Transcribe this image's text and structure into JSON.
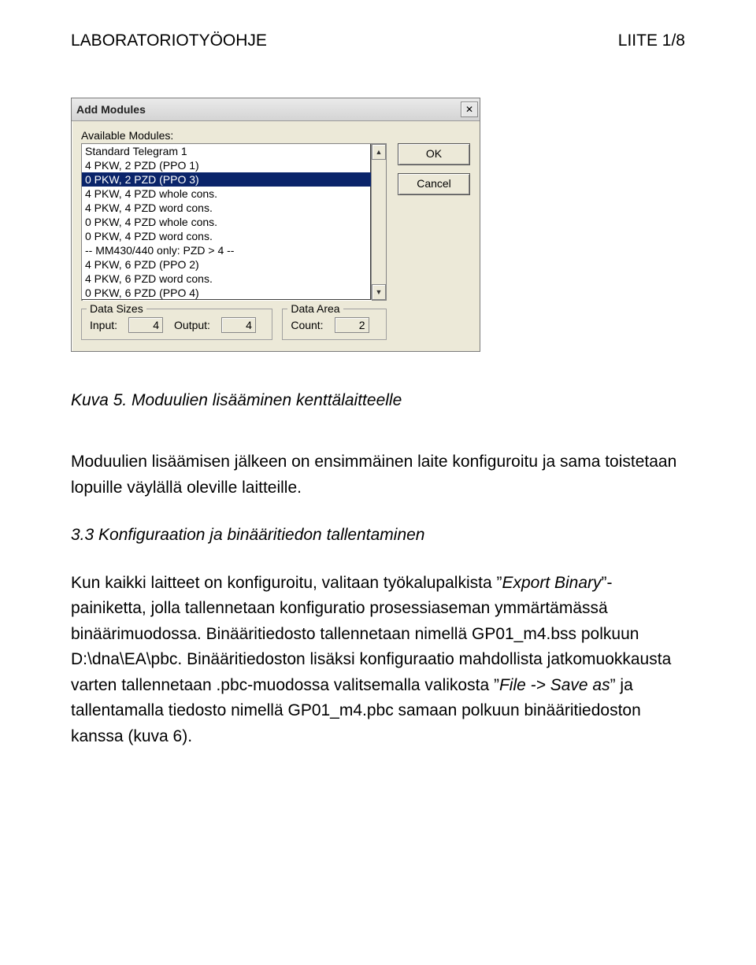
{
  "header": {
    "left": "LABORATORIOTYÖOHJE",
    "right": "LIITE 1/8"
  },
  "dialog": {
    "title": "Add Modules",
    "label": "Available Modules:",
    "items": [
      "Standard Telegram 1",
      "4 PKW,  2 PZD  (PPO 1)",
      "0 PKW,  2 PZD  (PPO 3)",
      "4 PKW,  4 PZD  whole cons.",
      "4 PKW,  4 PZD  word cons.",
      "0 PKW,  4 PZD  whole cons.",
      "0 PKW,  4 PZD  word cons.",
      "-- MM430/440 only: PZD > 4 --",
      "4 PKW,  6 PZD  (PPO 2)",
      "4 PKW,  6 PZD  word cons.",
      "0 PKW,  6 PZD  (PPO 4)"
    ],
    "selected_index": 2,
    "ok": "OK",
    "cancel": "Cancel",
    "data_sizes": {
      "legend": "Data Sizes",
      "input_label": "Input:",
      "input_value": "4",
      "output_label": "Output:",
      "output_value": "4"
    },
    "data_area": {
      "legend": "Data Area",
      "count_label": "Count:",
      "count_value": "2"
    }
  },
  "caption": "Kuva 5. Moduulien lisääminen kenttälaitteelle",
  "paragraph1": "Moduulien lisäämisen jälkeen on ensimmäinen laite konfiguroitu ja sama toistetaan lopuille väylällä oleville laitteille.",
  "section_heading": "3.3 Konfiguraation ja binääritiedon tallentaminen",
  "paragraph2_a": "Kun kaikki laitteet on konfiguroitu, valitaan työkalupalkista ”",
  "paragraph2_b": "Export Binary",
  "paragraph2_c": "”-painiketta, jolla tallennetaan konfiguratio prosessiaseman ymmärtämässä binäärimuodossa. Binääritiedosto tallennetaan nimellä GP01_m4.bss polkuun D:\\dna\\EA\\pbc. Binääritiedoston lisäksi konfiguraatio mahdollista jatkomuokkausta varten tallennetaan .pbc-muodossa valitsemalla valikosta ”",
  "paragraph2_d": "File -> Save as",
  "paragraph2_e": "” ja tallentamalla tiedosto nimellä GP01_m4.pbc samaan polkuun binääritiedoston kanssa (kuva 6)."
}
